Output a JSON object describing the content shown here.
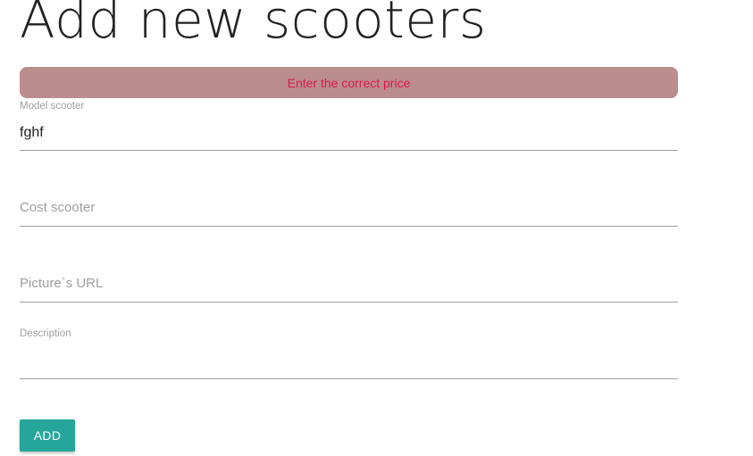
{
  "page": {
    "title": "Add new scooters"
  },
  "alert": {
    "message": "Enter the correct price",
    "background_color": "#bc8d8d",
    "text_color": "#d81b4a"
  },
  "form": {
    "model": {
      "label": "Model scooter",
      "value": "fghf"
    },
    "cost": {
      "label": "Cost scooter",
      "value": ""
    },
    "picture_url": {
      "label": "Picture`s URL",
      "value": ""
    },
    "description": {
      "label": "Description",
      "value": ""
    }
  },
  "actions": {
    "add_label": "ADD",
    "add_color": "#26a69a"
  }
}
